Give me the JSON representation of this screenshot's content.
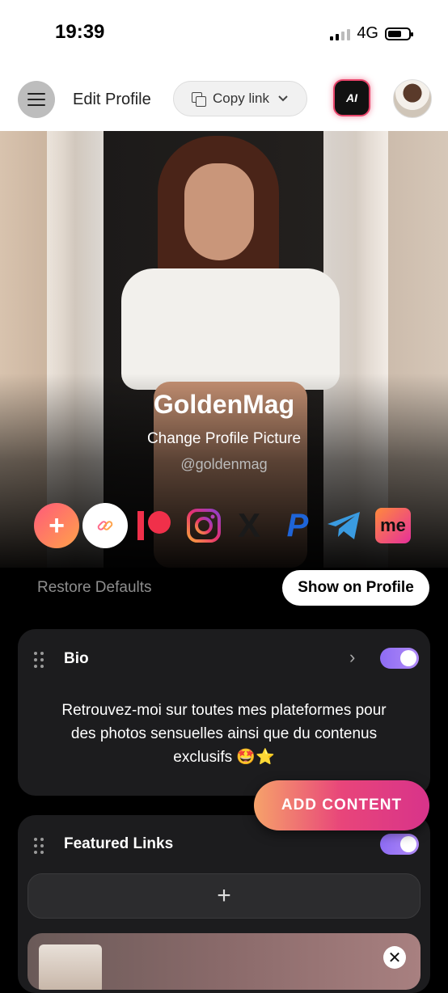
{
  "status_bar": {
    "time": "19:39",
    "network": "4G"
  },
  "header": {
    "title": "Edit Profile",
    "copy_link_label": "Copy link",
    "ai_label": "AI"
  },
  "profile": {
    "name": "GoldenMag",
    "change_picture_label": "Change Profile Picture",
    "handle": "@goldenmag"
  },
  "socials": {
    "add_symbol": "+",
    "items": [
      "add-icon",
      "link-icon",
      "patreon-icon",
      "instagram-icon",
      "x-icon",
      "paypal-icon",
      "telegram-icon",
      "me-icon"
    ],
    "x_glyph": "X",
    "paypal_glyph": "P",
    "me_glyph": "me"
  },
  "actions": {
    "restore_label": "Restore Defaults",
    "show_on_profile_label": "Show on Profile",
    "add_content_label": "ADD CONTENT"
  },
  "bio_card": {
    "title": "Bio",
    "text": "Retrouvez-moi sur toutes mes plateformes pour des photos sensuelles ainsi que du contenus exclusifs 🤩⭐",
    "enabled": true
  },
  "featured_links_card": {
    "title": "Featured Links",
    "add_symbol": "+",
    "enabled": true
  },
  "colors": {
    "accent_gradient_start": "#f6a26a",
    "accent_gradient_end": "#d8338a",
    "toggle_on": "#8e6cf4",
    "ai_border": "#e8456b"
  }
}
